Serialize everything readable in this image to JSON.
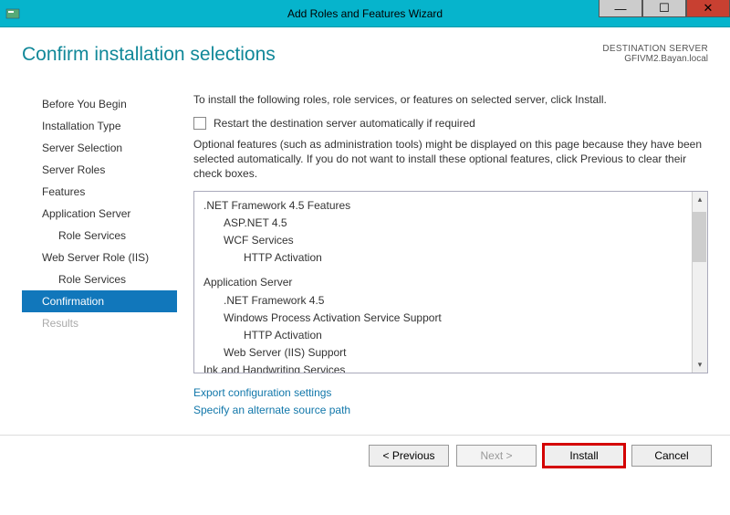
{
  "titlebar": {
    "title": "Add Roles and Features Wizard"
  },
  "header": {
    "page_title": "Confirm installation selections",
    "dest_label": "DESTINATION SERVER",
    "dest_value": "GFIVM2.Bayan.local"
  },
  "sidebar": {
    "items": [
      {
        "label": "Before You Begin"
      },
      {
        "label": "Installation Type"
      },
      {
        "label": "Server Selection"
      },
      {
        "label": "Server Roles"
      },
      {
        "label": "Features"
      },
      {
        "label": "Application Server"
      },
      {
        "label": "Role Services",
        "sub": true
      },
      {
        "label": "Web Server Role (IIS)"
      },
      {
        "label": "Role Services",
        "sub": true
      },
      {
        "label": "Confirmation",
        "selected": true
      },
      {
        "label": "Results",
        "disabled": true
      }
    ]
  },
  "main": {
    "instruction": "To install the following roles, role services, or features on selected server, click Install.",
    "checkbox_label": "Restart the destination server automatically if required",
    "optional_text": "Optional features (such as administration tools) might be displayed on this page because they have been selected automatically. If you do not want to install these optional features, click Previous to clear their check boxes.",
    "list": [
      {
        "text": ".NET Framework 4.5 Features",
        "level": 0
      },
      {
        "text": "ASP.NET 4.5",
        "level": 1
      },
      {
        "text": "WCF Services",
        "level": 1
      },
      {
        "text": "HTTP Activation",
        "level": 2
      },
      {
        "text": "",
        "level": 0
      },
      {
        "text": "Application Server",
        "level": 0
      },
      {
        "text": ".NET Framework 4.5",
        "level": 1
      },
      {
        "text": "Windows Process Activation Service Support",
        "level": 1
      },
      {
        "text": "HTTP Activation",
        "level": 2
      },
      {
        "text": "Web Server (IIS) Support",
        "level": 1
      },
      {
        "text": "Ink and Handwriting Services",
        "level": 0
      }
    ],
    "link_export": "Export configuration settings",
    "link_source": "Specify an alternate source path"
  },
  "footer": {
    "previous": "< Previous",
    "next": "Next >",
    "install": "Install",
    "cancel": "Cancel"
  }
}
